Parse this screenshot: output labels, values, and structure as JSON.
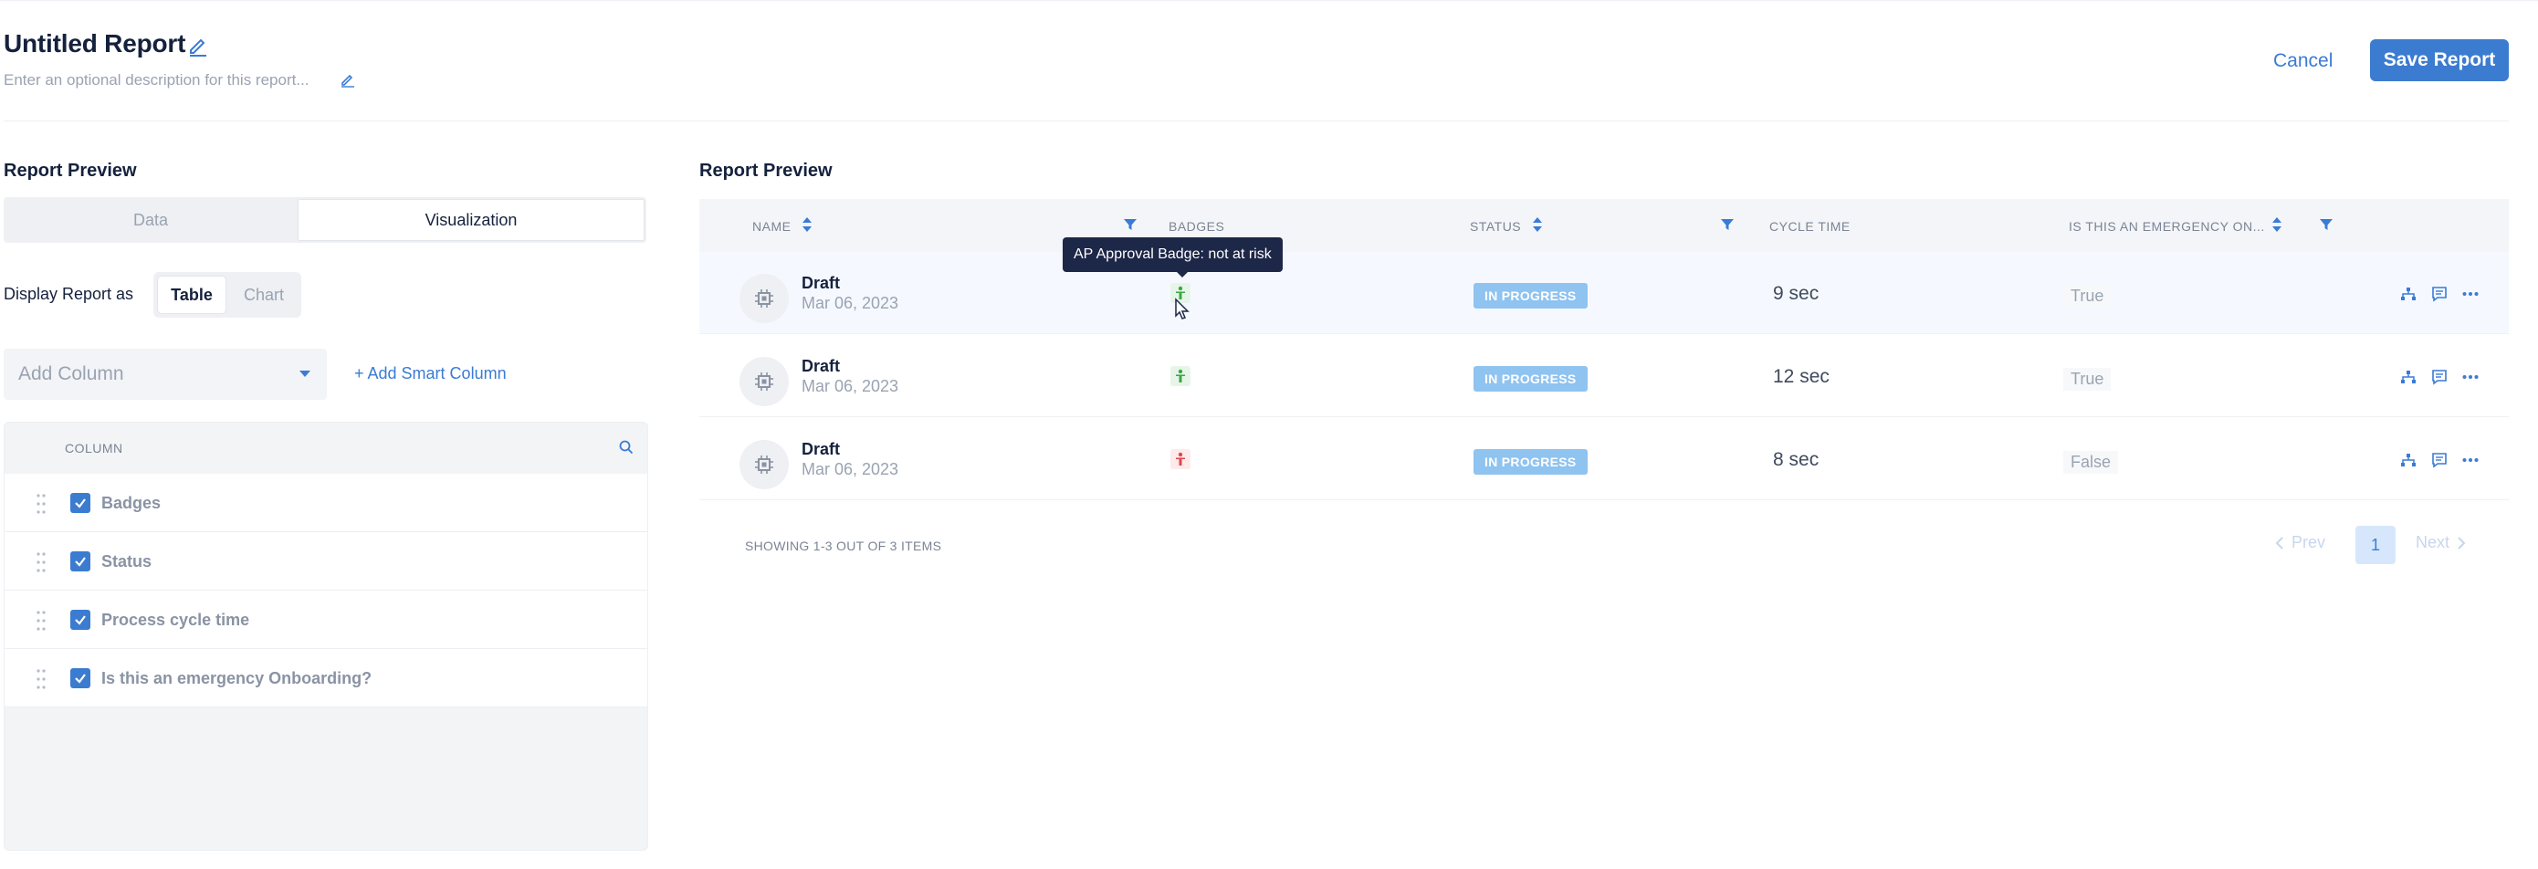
{
  "header": {
    "title": "Untitled Report",
    "description_placeholder": "Enter an optional description for this report...",
    "cancel_label": "Cancel",
    "save_label": "Save Report"
  },
  "left_panel": {
    "heading": "Report Preview",
    "tabs": [
      "Data",
      "Visualization"
    ],
    "active_tab": "Visualization",
    "display_label": "Display Report as",
    "display_options": [
      "Table",
      "Chart"
    ],
    "display_selected": "Table",
    "add_column_placeholder": "Add Column",
    "smart_column_label": "+ Add Smart Column",
    "columns_header": "COLUMN",
    "columns": [
      {
        "label": "Badges",
        "checked": true
      },
      {
        "label": "Status",
        "checked": true
      },
      {
        "label": "Process cycle time",
        "checked": true
      },
      {
        "label": "Is this an emergency Onboarding?",
        "checked": true
      }
    ]
  },
  "right_panel": {
    "heading": "Report Preview",
    "table_headers": [
      "NAME",
      "BADGES",
      "STATUS",
      "CYCLE TIME",
      "IS THIS AN EMERGENCY ON..."
    ],
    "rows": [
      {
        "name": "Draft",
        "date": "Mar 06, 2023",
        "badge_color": "#3aa845",
        "status": "IN PROGRESS",
        "cycle_time": "9 sec",
        "emergency": "True"
      },
      {
        "name": "Draft",
        "date": "Mar 06, 2023",
        "badge_color": "#3aa845",
        "status": "IN PROGRESS",
        "cycle_time": "12 sec",
        "emergency": "True"
      },
      {
        "name": "Draft",
        "date": "Mar 06, 2023",
        "badge_color": "#e0454b",
        "status": "IN PROGRESS",
        "cycle_time": "8 sec",
        "emergency": "False"
      }
    ],
    "showing_text": "SHOWING 1-3 OUT OF 3 ITEMS",
    "pagination": {
      "prev": "Prev",
      "current": "1",
      "next": "Next"
    },
    "tooltip": "AP Approval Badge: not at risk"
  },
  "colors": {
    "accent": "#3b7cd0",
    "status_pill": "#8fc3f0",
    "badge_green": "#3aa845",
    "badge_red": "#e0454b",
    "tooltip_bg": "#1d2747"
  },
  "icons": [
    "edit-pencil-icon",
    "search-icon",
    "drag-handle-icon",
    "checkbox-checked-icon",
    "sort-icon",
    "filter-icon",
    "processor-icon",
    "person-badge-icon",
    "hierarchy-icon",
    "comment-icon",
    "more-icon",
    "chevron-left-icon",
    "chevron-right-icon",
    "dropdown-caret-icon"
  ]
}
